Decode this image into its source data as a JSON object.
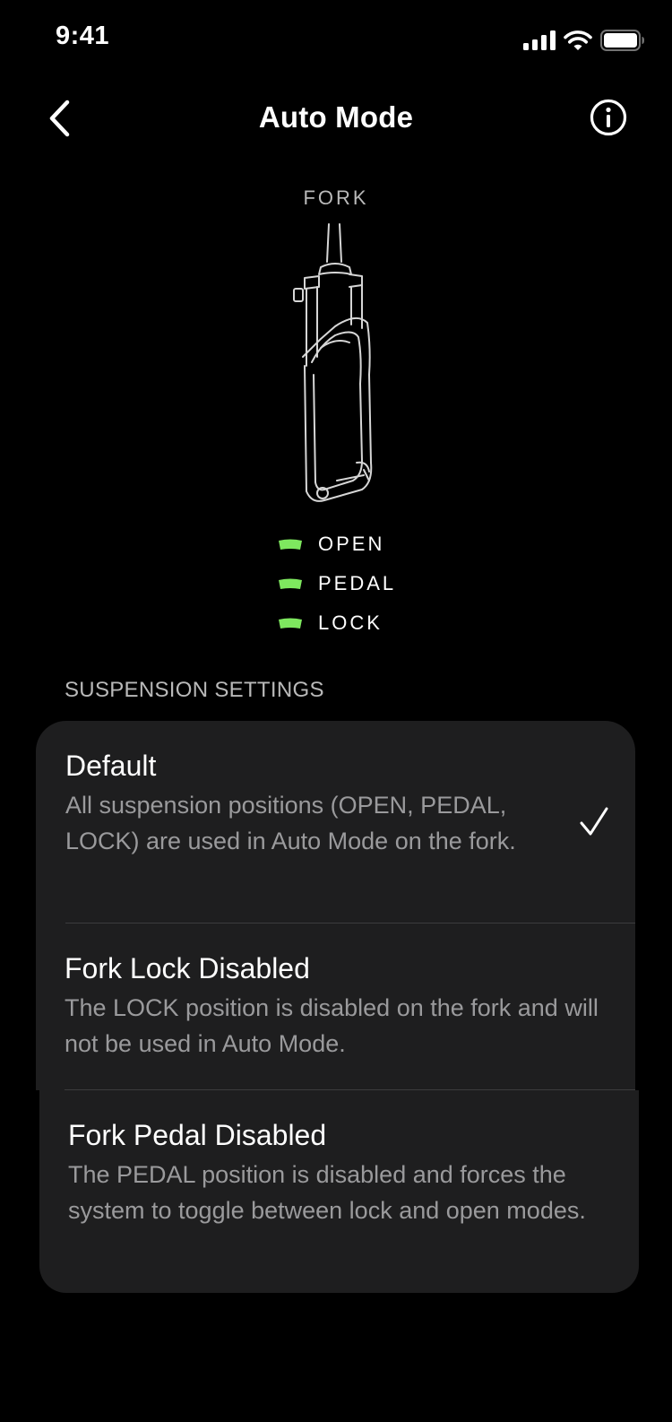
{
  "status_bar": {
    "time": "9:41"
  },
  "nav": {
    "title": "Auto Mode",
    "back_icon": "chevron-left-icon",
    "info_icon": "info-circle-icon"
  },
  "fork": {
    "label": "FORK"
  },
  "legend": {
    "accent_color": "#7ee85f",
    "items": [
      {
        "label": "OPEN"
      },
      {
        "label": "PEDAL"
      },
      {
        "label": "LOCK"
      }
    ]
  },
  "suspension_settings": {
    "header": "SUSPENSION SETTINGS",
    "selected": "Default",
    "options": [
      {
        "title": "Default",
        "description": "All suspension positions (OPEN, PEDAL, LOCK) are used in Auto Mode on the fork."
      },
      {
        "title": "Fork Lock Disabled",
        "description": "The LOCK position is disabled on the fork and will not be used in Auto Mode."
      },
      {
        "title": "Fork Pedal Disabled",
        "description": "The PEDAL position is disabled and forces the system to toggle between lock and open modes."
      }
    ]
  },
  "colors": {
    "background": "#000000",
    "card": "#1e1e1f",
    "secondary_text": "#9a9a9c",
    "accent": "#7ee85f"
  }
}
